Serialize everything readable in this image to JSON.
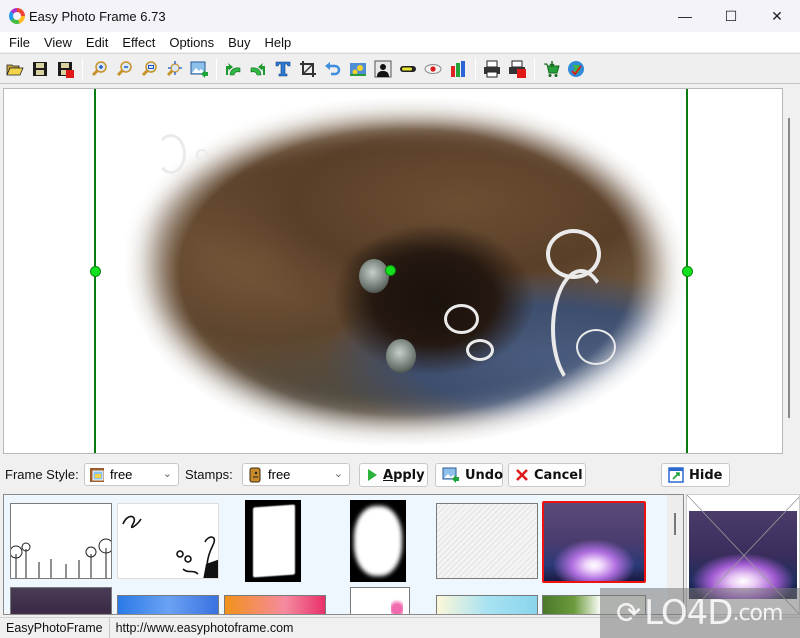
{
  "window": {
    "title": "Easy Photo Frame 6.73",
    "controls": {
      "minimize": "—",
      "maximize": "☐",
      "close": "✕"
    }
  },
  "menu": [
    "File",
    "View",
    "Edit",
    "Effect",
    "Options",
    "Buy",
    "Help"
  ],
  "toolbar": {
    "groups": [
      [
        "open-icon",
        "save-icon",
        "save-as-icon"
      ],
      [
        "zoom-in-icon",
        "zoom-out-icon",
        "zoom-fit-icon",
        "move-icon",
        "import-image-icon"
      ],
      [
        "rotate-left-icon",
        "rotate-right-icon",
        "text-icon",
        "crop-icon",
        "undo-icon",
        "photo-icon",
        "silhouette-icon",
        "brightness-icon",
        "red-eye-icon",
        "levels-icon"
      ],
      [
        "print-icon",
        "print-setup-icon"
      ],
      [
        "buy-icon",
        "website-icon"
      ]
    ]
  },
  "controls": {
    "frame_style_label": "Frame Style:",
    "frame_style_value": "free",
    "stamps_label": "Stamps:",
    "stamps_value": "free",
    "apply_label": "Apply",
    "apply_underline": "A",
    "apply_rest": "pply",
    "undo_label": "Undo",
    "cancel_label": "Cancel",
    "hide_label": "Hide"
  },
  "thumbnails": [
    {
      "name": "dandelion-frame",
      "selected": false
    },
    {
      "name": "swirl-frame",
      "selected": false
    },
    {
      "name": "torn-edge-frame",
      "selected": false
    },
    {
      "name": "cloud-mask-frame",
      "selected": false
    },
    {
      "name": "paper-texture-frame",
      "selected": false
    },
    {
      "name": "aurora-frame",
      "selected": true
    },
    {
      "name": "dark-purple-frame",
      "selected": false
    },
    {
      "name": "blue-bokeh-frame",
      "selected": false
    },
    {
      "name": "orange-pink-frame",
      "selected": false
    },
    {
      "name": "pink-flower-frame",
      "selected": false
    },
    {
      "name": "sky-frame",
      "selected": false
    },
    {
      "name": "leaves-frame",
      "selected": false
    }
  ],
  "statusbar": {
    "app_name": "EasyPhotoFrame",
    "url": "http://www.easyphotoframe.com"
  },
  "watermark": {
    "main": "LO4D",
    "suffix": ".com"
  },
  "colors": {
    "guide_line": "#0a7d12",
    "handle": "#14e01e",
    "selection": "#ee1111",
    "thumb_bg": "#eef7fd"
  }
}
